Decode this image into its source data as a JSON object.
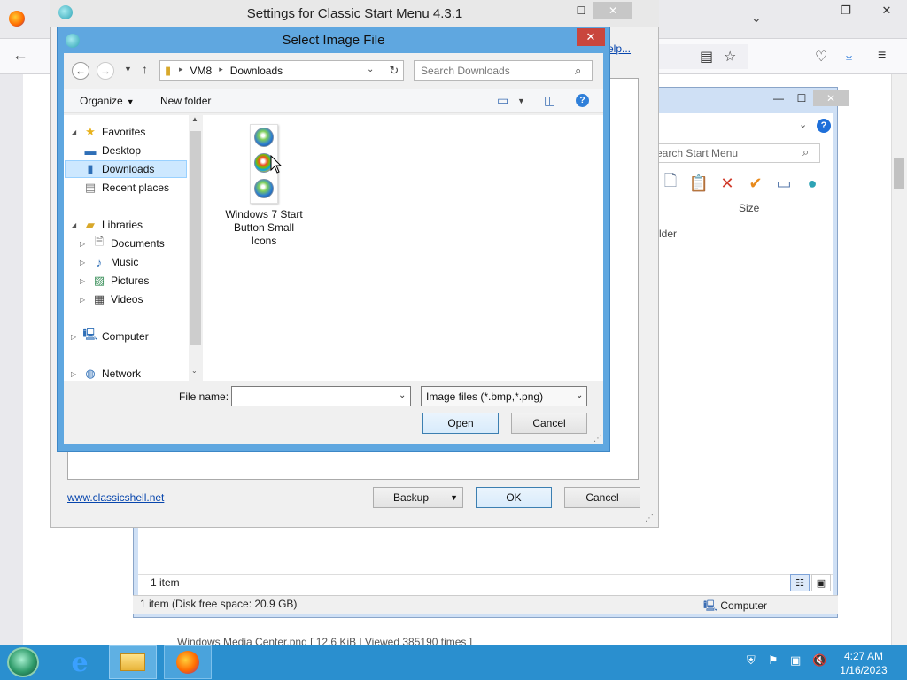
{
  "colors": {
    "taskbar": "#2a8fcf",
    "dialog_frame": "#5fa7e0",
    "close_red": "#c9463d",
    "selection": "#cde8ff",
    "link": "#0645ad"
  },
  "firefox": {
    "window_controls": [
      "—",
      "❐",
      "✕"
    ],
    "back_icon": "arrow-left-icon",
    "icons": [
      "reader-view-icon",
      "bookmark-star-icon",
      "pocket-icon",
      "download-icon",
      "menu-icon"
    ],
    "caption_fragment": "Windows Media Center.png [ 12.6 KiB | Viewed 385190 times ]"
  },
  "explorer": {
    "search_placeholder": "earch Start Menu",
    "column_size": "Size",
    "folder_fragment": "lder",
    "item_count": "1 item",
    "disk_status": "1 item (Disk free space: 20.9 GB)",
    "location": "Computer"
  },
  "settings": {
    "title": "Settings for Classic Start Menu 4.3.1",
    "help_fragment": "elp...",
    "website": "www.classicshell.net",
    "backup_label": "Backup",
    "ok_label": "OK",
    "cancel_label": "Cancel"
  },
  "dialog": {
    "title": "Select Image File",
    "close": "✕",
    "address_path": [
      "VM8",
      "Downloads"
    ],
    "address_sep": "▸",
    "search_placeholder": "Search Downloads",
    "organize_label": "Organize",
    "new_folder_label": "New folder",
    "tree": {
      "favorites": "Favorites",
      "desktop": "Desktop",
      "downloads": "Downloads",
      "recent": "Recent places",
      "libraries": "Libraries",
      "documents": "Documents",
      "music": "Music",
      "pictures": "Pictures",
      "videos": "Videos",
      "computer": "Computer",
      "network": "Network"
    },
    "file": {
      "name": "Windows 7 Start Button Small Icons"
    },
    "file_name_label": "File name:",
    "file_name_value": "",
    "filter": "Image files (*.bmp,*.png)",
    "open_label": "Open",
    "cancel_label": "Cancel"
  },
  "taskbar": {
    "time": "4:27 AM",
    "date": "1/16/2023"
  }
}
